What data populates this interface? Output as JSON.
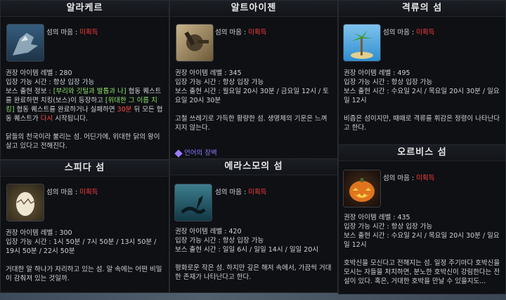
{
  "cards": [
    {
      "title": "알라케르",
      "heart_label": "섬의 마음 :",
      "heart_value": "미획득",
      "icon": "gargoyle-icon",
      "level": "권장 아이템 레벨 : 280",
      "entry": "입장 가능 시간 : 항상 입장 가능",
      "boss_a": "보스 출현 정보 : ",
      "boss_hl1": "[부리와 깃털과 발톱과 나]",
      "boss_b": " 협동 퀘스트를 완료하면 치킹(보스)이 등장하고 ",
      "boss_hl2": "[위대한 그 이름 치킹]",
      "boss_c": " 협동 퀘스트를 완료하거나 실패하면 ",
      "boss_red1": "30분",
      "boss_d": " 뒤 모든 협동 퀘스트가 ",
      "boss_red2": "다시",
      "boss_e": " 시작됩니다.",
      "desc": "닭들의 천국이라 불리는 섬. 어딘가에, 위대한 닭의 왕이 살고 있다고 전해진다."
    },
    {
      "title": "알트아이젠",
      "heart_label": "섬의 마음 :",
      "heart_value": "미획득",
      "icon": "scrap-robot-icon",
      "level": "권장 아이템 레벨 : 345",
      "entry": "입장 가능 시간 : 항상 입장 가능",
      "boss": "보스 출현 시간 : 월요일 20시 30분 / 금요일 12시 / 토요일 20시 30분",
      "desc": "고철 쓰레기로 가득한 황량한 섬. 생명체의 기운은 느껴지지 않는다.",
      "link": "언어의 장벽"
    },
    {
      "title": "격류의 섬",
      "heart_label": "섬의 마음 :",
      "heart_value": "미획득",
      "icon": "palm-island-icon",
      "level": "권장 아이템 레벨 : 495",
      "entry": "입장 가능 시간 : 항상 입장 가능",
      "boss": "보스 출현 시간 : 수요일 2시 / 목요일 20시 30분 / 일요일 12시",
      "desc": "비좁은 섬이지만, 때때로 격류를 휘감은 정령이 나타난다고 한다."
    },
    {
      "title": "스피다 섬",
      "heart_label": "섬의 마음 :",
      "heart_value": "미획득",
      "icon": "cracked-egg-icon",
      "level": "권장 아이템 레벨 : 300",
      "entry": "입장 가능 시간 : 1시 50분 / 7시 50분 / 13시 50분 / 19시 50분 / 22시 50분",
      "desc": "거대한 알 하나가 자리하고 있는 섬. 알 속에는 어떤 비밀이 감춰져 있는 것일까."
    },
    {
      "title": "에라스모의 섬",
      "heart_label": "섬의 마음 :",
      "heart_value": "미획득",
      "icon": "sea-serpent-icon",
      "level": "권장 아이템 레벨 : 420",
      "entry": "입장 가능 시간 : 항상 입장 가능",
      "boss": "보스 출현 시간 : 일일 6시 / 일일 14시 / 일일 20시",
      "desc": "평화로운 작은 섬. 하지만 깊은 해저 속에서, 가끔씩 거대한 존재가 나타난다고 한다."
    },
    {
      "title": "오르비스 섬",
      "heart_label": "섬의 마음 :",
      "heart_value": "미획득",
      "icon": "pumpkin-icon",
      "level": "권장 아이템 레벨 : 435",
      "entry": "입장 가능 시간 : 항상 입장 가능",
      "boss": "보스 출현 시간 : 수요일 2시 / 목요일 20시 30분 / 일요일 12시",
      "desc": "호박신을 모신다고 전해지는 섬. 일정 주기마다 호박신을 모시는 자들을 처치하면, 분노한 호박신이 강림한다는 전설이 있다. 혹은, 거대한 호박을 만날 수 있을지도..."
    }
  ]
}
